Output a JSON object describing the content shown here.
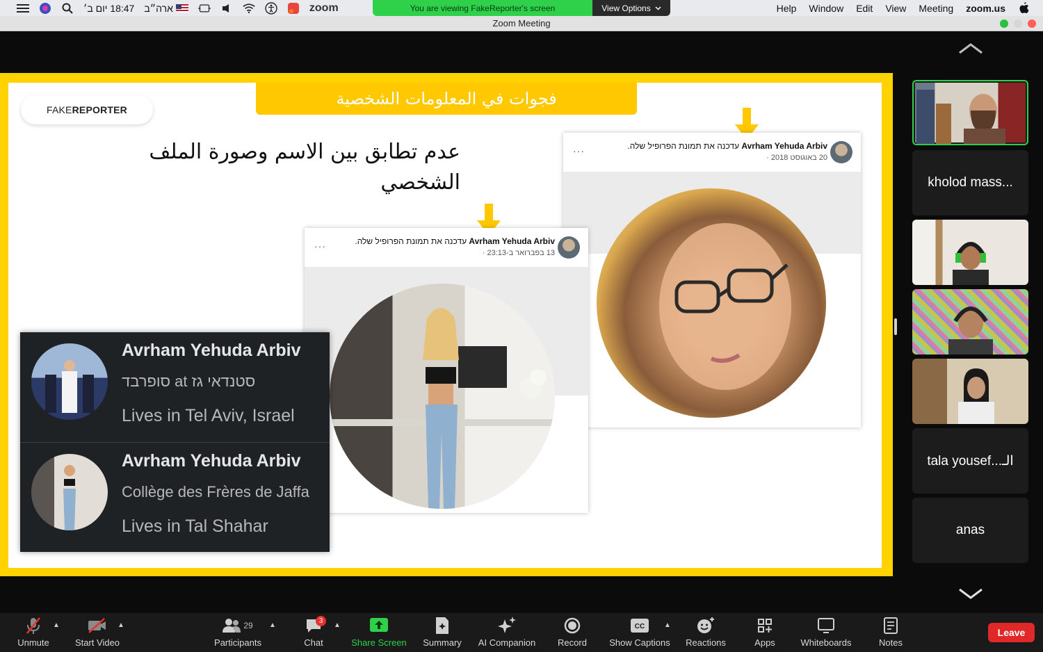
{
  "menubar": {
    "time_text": "18:47 יום ב׳",
    "region": "ארה״ב",
    "app_name": "zoom",
    "items": [
      "Help",
      "Window",
      "Edit",
      "View",
      "Meeting",
      "zoom.us"
    ]
  },
  "banner": {
    "viewing_text": "You are viewing FakeReporter's screen",
    "view_options": "View Options"
  },
  "window": {
    "title": "Zoom Meeting"
  },
  "slide": {
    "logo_regular": "FAKE",
    "logo_bold": "REPORTER",
    "title": "فجوات في المعلومات الشخصية",
    "heading_line1": "عدم تطابق بين الاسم وصورة الملف",
    "heading_line2": "الشخصي",
    "post_right": {
      "name": "Avrham Yehuda Arbiv",
      "action": "עדכנה את תמונת הפרופיל שלה.",
      "date": "20 באוגוסט 2018 ·",
      "menu": "···"
    },
    "post_middle": {
      "name": "Avrham Yehuda Arbiv",
      "action": "עדכנה את תמונת הפרופיל שלה.",
      "date": "13 בפברואר ב-23:13 ·",
      "menu": "···"
    },
    "profiles": [
      {
        "name": "Avrham Yehuda Arbiv",
        "line1": "סופרבד at סטנדאי גז",
        "line2": "Lives in Tel Aviv, Israel"
      },
      {
        "name": "Avrham Yehuda Arbiv",
        "line1": "Collège des Frères de Jaffa",
        "line2": "Lives in Tal Shahar"
      }
    ]
  },
  "gallery": {
    "tiles": [
      {
        "label": ""
      },
      {
        "label": "kholod mass..."
      },
      {
        "label": ""
      },
      {
        "label": ""
      },
      {
        "label": ""
      },
      {
        "label": "tala yousef...الـ"
      },
      {
        "label": "anas"
      }
    ]
  },
  "toolbar": {
    "unmute": "Unmute",
    "start_video": "Start Video",
    "participants": "Participants",
    "participants_count": "29",
    "chat": "Chat",
    "chat_badge": "3",
    "share_screen": "Share Screen",
    "summary": "Summary",
    "ai_companion": "AI Companion",
    "record": "Record",
    "show_captions": "Show Captions",
    "reactions": "Reactions",
    "apps": "Apps",
    "whiteboards": "Whiteboards",
    "notes": "Notes",
    "leave": "Leave"
  },
  "colors": {
    "accent_green": "#2fd14a",
    "slide_yellow": "#ffd200",
    "leave_red": "#e02828"
  }
}
